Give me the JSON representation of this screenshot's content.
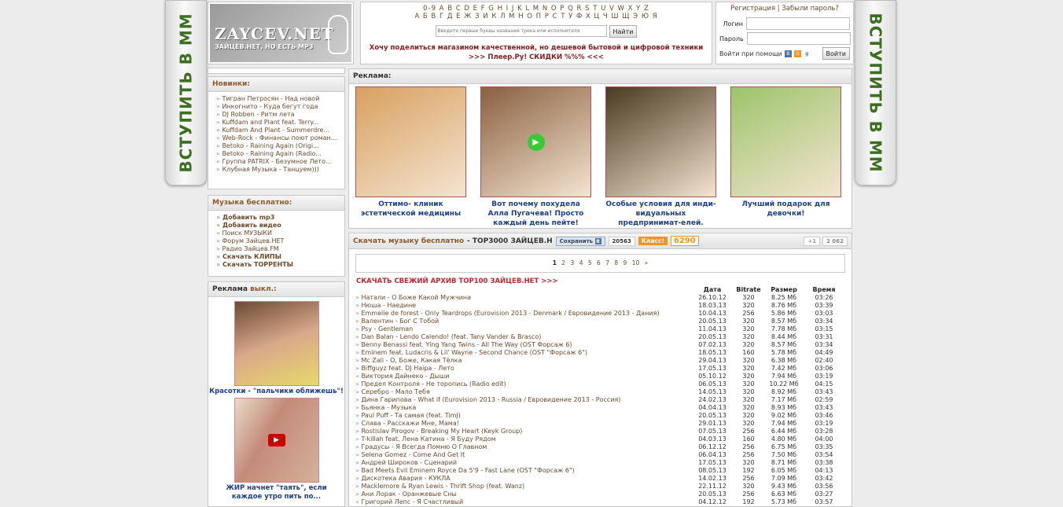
{
  "side_banner": "ВСТУПИТЬ В ММ",
  "logo": {
    "title": "ZAYCEV.NET",
    "subtitle": "ЗАЙЦЕВ.НЕТ, НО ЕСТЬ MP3"
  },
  "alphabet": {
    "latin": "0-9 A B C D E F G H I J K L M N O P Q R S T U V W X Y Z",
    "cyrillic": "А Б В Г Д Е Ж З И К Л М Н О П Р С Т У Ф Х Ц Ч Ш Щ Э Ю Я"
  },
  "search": {
    "placeholder": "Введите первые буквы названия трека или исполнителя",
    "button": "Найти"
  },
  "promo": {
    "line1": "Хочу поделиться магазином качественной, но дешевой бытовой и цифровой техники",
    "line2": ">>> Плеер.Ру! СКИДКИ %%% <<<"
  },
  "login": {
    "register": "Регистрация",
    "sep": "|",
    "forgot": "Забыли пароль?",
    "login_label": "Логин",
    "password_label": "Пароль",
    "via": "Войти при помощи",
    "button": "Войти"
  },
  "news": {
    "title": "Новинки:",
    "items": [
      "Тигран Петросян - Над новой",
      "Инкогнито - Куда бегут года",
      "DJ Robben - Ритм лета",
      "Kuffdam and Plant feat. Terry...",
      "Kuffdam And Plant - Summerdre...",
      "Web-Rock - Финансы поют роман...",
      "Betoko - Raining Again (Origi...",
      "Betoko - Raining Again (Radio...",
      "Группа PATRIX - Безумное Лето...",
      "Клубная Музыка - Танцуем)))"
    ]
  },
  "free_music": {
    "title": "Музыка бесплатно:",
    "items": [
      {
        "label": "Добавить mp3",
        "bold": true
      },
      {
        "label": "Добавить видео",
        "bold": true
      },
      {
        "label": "Поиск МУЗЫКИ",
        "bold": false
      },
      {
        "label": "Форум Зайцев.НЕТ",
        "bold": false
      },
      {
        "label": "Радио Зайцев.FM",
        "bold": false
      },
      {
        "label": "Скачать КЛИПЫ",
        "bold": true
      },
      {
        "label": "Скачать ТОРРЕНТЫ",
        "bold": true
      }
    ]
  },
  "left_ads": {
    "title": "Реклама",
    "off": "выкл.:",
    "cap1": "Красотки - \"пальчики оближешь\"!",
    "cap2": "ЖИР начнет \"таять\", если каждое утро пить по..."
  },
  "ads": {
    "title": "Реклама:",
    "items": [
      {
        "caption": "Оттимо- клиник эстетической медицины",
        "color": "#d8a060"
      },
      {
        "caption": "Вот почему похудела Алла Пугачева! Просто каждый день пейте!",
        "color": "#8a6040"
      },
      {
        "caption": "Особые условия для инди-видуальных предпринимат-елей.",
        "color": "#4a3a20"
      },
      {
        "caption": "Лучший подарок для девочки!",
        "color": "#9cc46a"
      }
    ]
  },
  "music": {
    "title_a": "Скачать музыку бесплатно",
    "title_b": "- TOP3000 ЗАЙЦЕВ.Н",
    "save": "Сохранить",
    "save_count": "20563",
    "ok_label": "Класс!",
    "ok_count": "6290",
    "plus": "+1",
    "plus_count": "2 062",
    "pages": [
      "1",
      "2",
      "3",
      "4",
      "5",
      "6",
      "7",
      "8",
      "9",
      "10",
      "»"
    ],
    "archive": "СКАЧАТЬ СВЕЖИЙ АРХИВ TOP100 ЗАЙЦЕВ.НЕТ >>>",
    "columns": [
      "Дата",
      "Bitrate",
      "Размер",
      "Время"
    ],
    "tracks": [
      [
        "Натали - О Боже Какой Мужчина",
        "26.10.12",
        "320",
        "8.25 Мб",
        "03:26"
      ],
      [
        "Нюша - Наедине",
        "18.03.13",
        "320",
        "8.76 Мб",
        "03:39"
      ],
      [
        "Emmelie de forest - Only Teardrops (Eurovision 2013 - Denmark / Евровидение 2013 - Дания)",
        "10.04.13",
        "256",
        "5.86 Мб",
        "03:03"
      ],
      [
        "Валентин - Бог С Тобой",
        "20.05.13",
        "320",
        "8.57 Мб",
        "03:34"
      ],
      [
        "Psy - Gentleman",
        "11.04.13",
        "320",
        "7.78 Мб",
        "03:15"
      ],
      [
        "Dan Balan - Lendo Calendo! (feat. Tany Vander & Brasco)",
        "20.05.13",
        "320",
        "8.44 Мб",
        "03:31"
      ],
      [
        "Benny Benassi feat. Ying Yang Twins - All The Way (OST Форсаж 6)",
        "07.02.13",
        "320",
        "8.57 Мб",
        "03:34"
      ],
      [
        "Eminem feat. Ludacris & Lil' Wayne - Second Chance (OST \"Форсаж 6\")",
        "18.05.13",
        "160",
        "5.78 Мб",
        "04:49"
      ],
      [
        "Mc Zali - О, Боже, Какая Тёлка",
        "29.04.13",
        "320",
        "6.38 Мб",
        "02:40"
      ],
      [
        "Biffguyz feat. DJ Haipa - Лето",
        "17.05.13",
        "320",
        "7.42 Мб",
        "03:06"
      ],
      [
        "Виктория Дайнеко - Дыши",
        "05.10.12",
        "320",
        "7.94 Мб",
        "03:19"
      ],
      [
        "Предел Контроля - Не торопись (Radio edit)",
        "06.05.13",
        "320",
        "10.22 Мб",
        "04:15"
      ],
      [
        "Серебро - Мало Тебя",
        "14.05.13",
        "320",
        "8.92 Мб",
        "03:43"
      ],
      [
        "Дина Гарипова - What if (Eurovision 2013 - Russia / Евровидение 2013 - Россия)",
        "24.02.13",
        "320",
        "7.17 Мб",
        "02:59"
      ],
      [
        "Бьянка - Музыка",
        "04.04.13",
        "320",
        "8.93 Мб",
        "03:43"
      ],
      [
        "Paul Puff - Та самая (feat. TimJ)",
        "20.05.13",
        "320",
        "9.02 Мб",
        "03:46"
      ],
      [
        "Слава - Расскажи Мне, Мама!",
        "29.01.13",
        "320",
        "7.94 Мб",
        "03:19"
      ],
      [
        "Rostislav Pirogov - Breaking My Heart (Keyk Group)",
        "07.05.13",
        "256",
        "6.44 Мб",
        "03:28"
      ],
      [
        "T-killah feat. Лена Катина - Я Буду Рядом",
        "04.03.13",
        "160",
        "4.80 Мб",
        "04:00"
      ],
      [
        "Градусы - Я Всегда Помню О Главном",
        "06.12.12",
        "256",
        "6.75 Мб",
        "03:35"
      ],
      [
        "Selena Gomez - Come And Get It",
        "06.04.13",
        "256",
        "7.50 Мб",
        "03:54"
      ],
      [
        "Андрей Широков - Сценарий",
        "17.05.13",
        "320",
        "8.71 Мб",
        "03:38"
      ],
      [
        "Bad Meets Evil Eminem Royce Da 5'9 - Fast Lane (OST \"Форсаж 6\")",
        "08.05.13",
        "192",
        "6.05 Мб",
        "04:13"
      ],
      [
        "Дискотека Авария - КУКЛА",
        "14.02.13",
        "256",
        "7.09 Мб",
        "03:42"
      ],
      [
        "Macklemore & Ryan Lewis - Thrift Shop (feat. Wanz)",
        "22.11.12",
        "320",
        "9.43 Мб",
        "03:56"
      ],
      [
        "Ани Лорак - Оранжевые Сны",
        "20.05.13",
        "256",
        "6.63 Мб",
        "03:27"
      ],
      [
        "Григорий Лепс - Я Счастливый",
        "04.12.12",
        "192",
        "5.73 Мб",
        "03:57"
      ]
    ]
  }
}
